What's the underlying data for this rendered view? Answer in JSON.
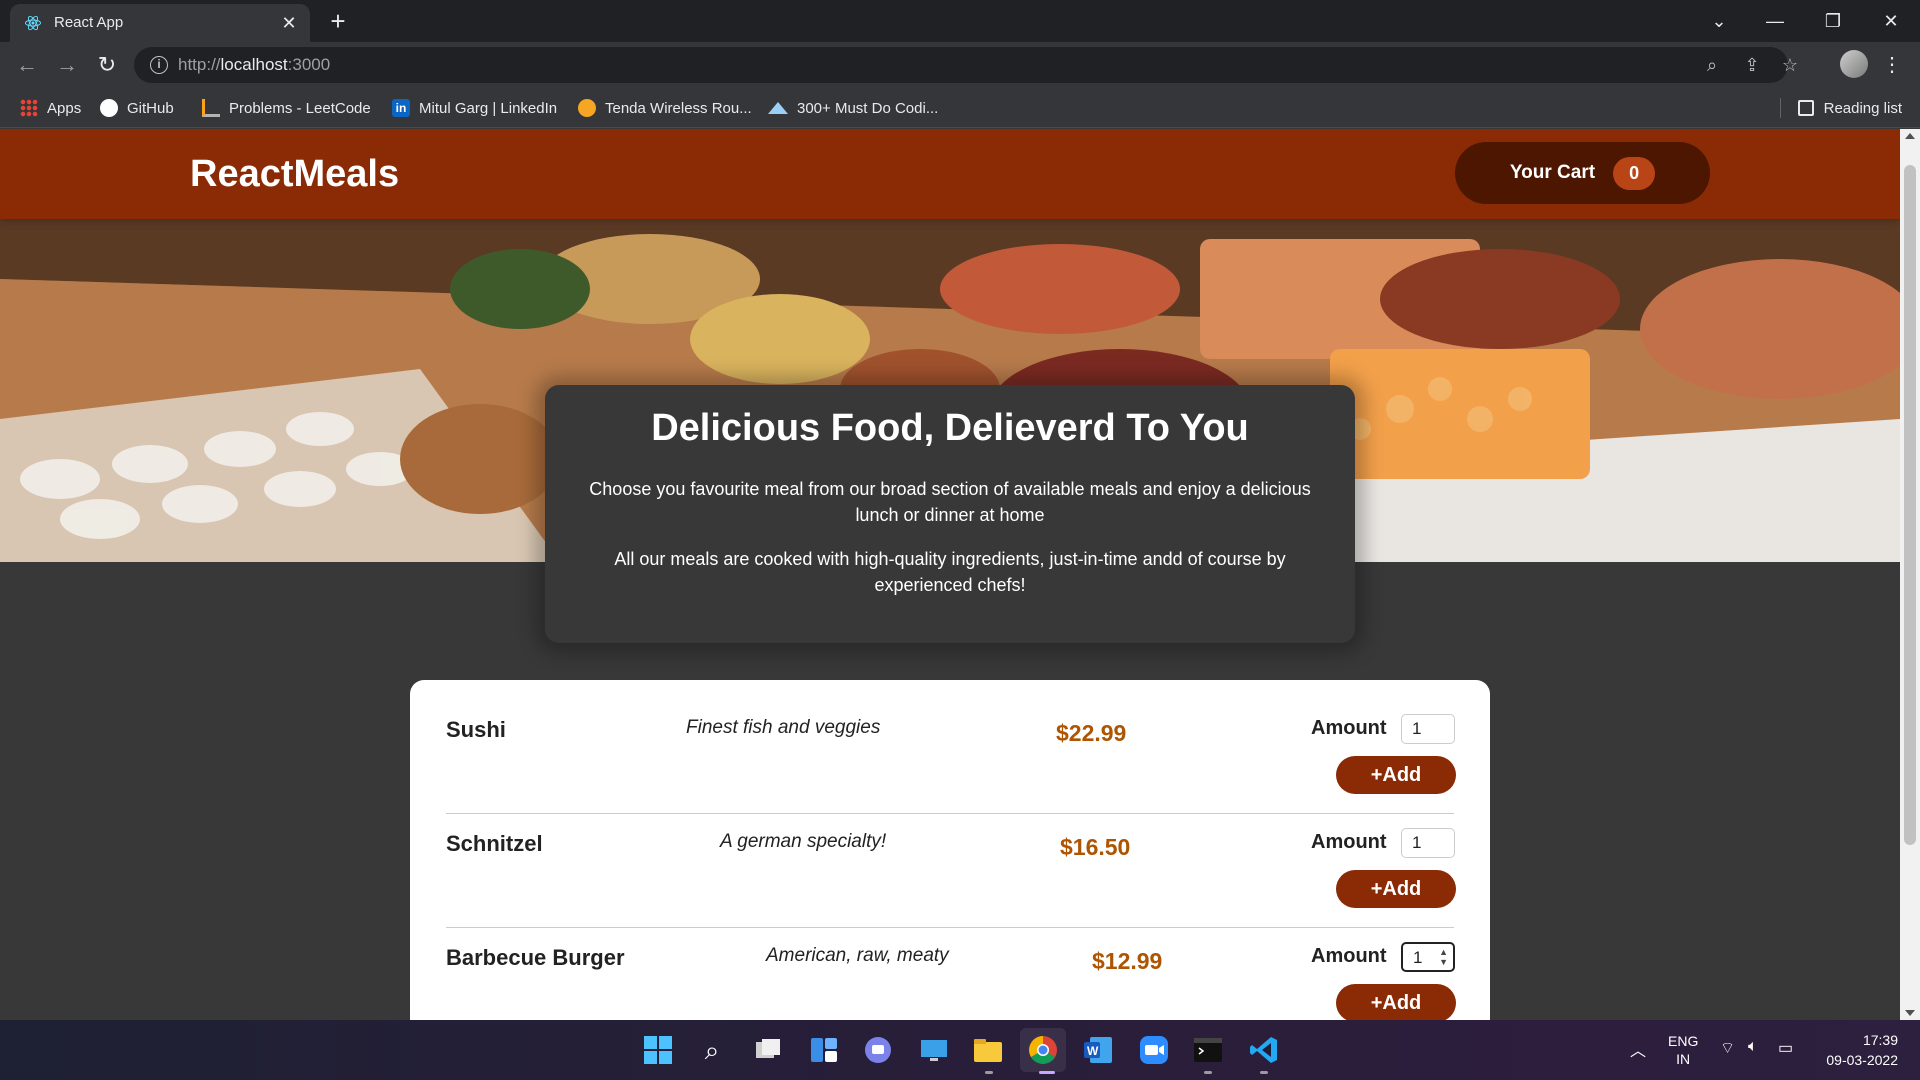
{
  "browser": {
    "tab_title": "React App",
    "url_scheme": "http://",
    "url_host": "localhost",
    "url_port": ":3000",
    "bookmarks": [
      {
        "label": "Apps",
        "icon": "apps-grid-icon"
      },
      {
        "label": "GitHub",
        "icon": "github-icon"
      },
      {
        "label": "Problems - LeetCode",
        "icon": "leetcode-icon"
      },
      {
        "label": "Mitul Garg | LinkedIn",
        "icon": "linkedin-icon"
      },
      {
        "label": "Tenda Wireless Rou...",
        "icon": "tenda-icon"
      },
      {
        "label": "300+ Must Do Codi...",
        "icon": "mountain-icon"
      }
    ],
    "reading_list": "Reading list"
  },
  "header": {
    "logo": "ReactMeals",
    "cart_label": "Your Cart",
    "cart_count": "0"
  },
  "summary": {
    "title": "Delicious Food, Delieverd To You",
    "paragraph1": "Choose you favourite meal from our broad section of available meals and enjoy a delicious lunch or dinner at home",
    "paragraph2": "All our meals are cooked with high-quality ingredients, just-in-time andd of course by experienced chefs!"
  },
  "meals": [
    {
      "name": "Sushi",
      "description": "Finest fish and veggies",
      "price": "$22.99",
      "amount_label": "Amount",
      "amount": "1",
      "add_label": "+Add"
    },
    {
      "name": "Schnitzel",
      "description": "A german specialty!",
      "price": "$16.50",
      "amount_label": "Amount",
      "amount": "1",
      "add_label": "+Add"
    },
    {
      "name": "Barbecue Burger",
      "description": "American, raw, meaty",
      "price": "$12.99",
      "amount_label": "Amount",
      "amount": "1",
      "add_label": "+Add"
    }
  ],
  "taskbar": {
    "lang_line1": "ENG",
    "lang_line2": "IN",
    "time": "17:39",
    "date": "09-03-2022"
  },
  "colors": {
    "header": "#8a2b06",
    "cart_button": "#4d1601",
    "cart_badge": "#b94517",
    "price": "#ad5502",
    "add_button": "#8a2b06",
    "page_background": "#383838"
  }
}
